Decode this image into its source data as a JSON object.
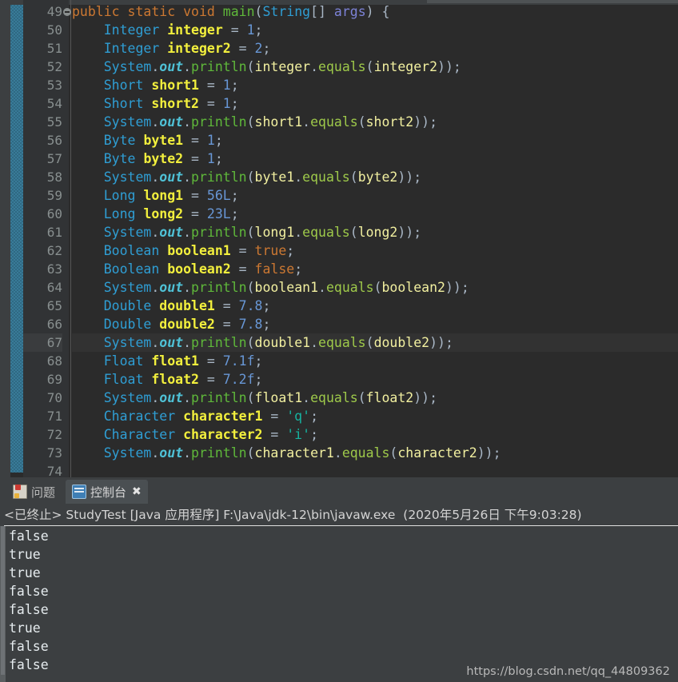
{
  "editor": {
    "top_partial_line": "",
    "current_line": 67,
    "lines": [
      {
        "n": "49",
        "fold": true,
        "tokens": [
          {
            "t": "public",
            "c": "kw"
          },
          {
            "t": " ",
            "c": "pn"
          },
          {
            "t": "static",
            "c": "kw"
          },
          {
            "t": " ",
            "c": "pn"
          },
          {
            "t": "void",
            "c": "kw"
          },
          {
            "t": " ",
            "c": "pn"
          },
          {
            "t": "main",
            "c": "mth"
          },
          {
            "t": "(",
            "c": "pn"
          },
          {
            "t": "String",
            "c": "cls"
          },
          {
            "t": "[] ",
            "c": "pn"
          },
          {
            "t": "args",
            "c": "args"
          },
          {
            "t": ") {",
            "c": "pn"
          }
        ]
      },
      {
        "n": "50",
        "fold": false,
        "tokens": [
          {
            "t": "    ",
            "c": "pn"
          },
          {
            "t": "Integer",
            "c": "type"
          },
          {
            "t": " ",
            "c": "pn"
          },
          {
            "t": "integer",
            "c": "var"
          },
          {
            "t": " = ",
            "c": "pn"
          },
          {
            "t": "1",
            "c": "num"
          },
          {
            "t": ";",
            "c": "semi"
          }
        ]
      },
      {
        "n": "51",
        "fold": false,
        "tokens": [
          {
            "t": "    ",
            "c": "pn"
          },
          {
            "t": "Integer",
            "c": "type"
          },
          {
            "t": " ",
            "c": "pn"
          },
          {
            "t": "integer2",
            "c": "var"
          },
          {
            "t": " = ",
            "c": "pn"
          },
          {
            "t": "2",
            "c": "num"
          },
          {
            "t": ";",
            "c": "semi"
          }
        ]
      },
      {
        "n": "52",
        "fold": false,
        "tokens": [
          {
            "t": "    ",
            "c": "pn"
          },
          {
            "t": "System",
            "c": "cls"
          },
          {
            "t": ".",
            "c": "pn"
          },
          {
            "t": "out",
            "c": "fld"
          },
          {
            "t": ".",
            "c": "pn"
          },
          {
            "t": "println",
            "c": "mth"
          },
          {
            "t": "(",
            "c": "pn"
          },
          {
            "t": "integer",
            "c": "varl"
          },
          {
            "t": ".",
            "c": "pn"
          },
          {
            "t": "equals",
            "c": "eqs"
          },
          {
            "t": "(",
            "c": "pn"
          },
          {
            "t": "integer2",
            "c": "varl"
          },
          {
            "t": "));",
            "c": "pn"
          }
        ]
      },
      {
        "n": "53",
        "fold": false,
        "tokens": [
          {
            "t": "    ",
            "c": "pn"
          },
          {
            "t": "Short",
            "c": "type"
          },
          {
            "t": " ",
            "c": "pn"
          },
          {
            "t": "short1",
            "c": "var"
          },
          {
            "t": " = ",
            "c": "pn"
          },
          {
            "t": "1",
            "c": "num"
          },
          {
            "t": ";",
            "c": "semi"
          }
        ]
      },
      {
        "n": "54",
        "fold": false,
        "tokens": [
          {
            "t": "    ",
            "c": "pn"
          },
          {
            "t": "Short",
            "c": "type"
          },
          {
            "t": " ",
            "c": "pn"
          },
          {
            "t": "short2",
            "c": "var"
          },
          {
            "t": " = ",
            "c": "pn"
          },
          {
            "t": "1",
            "c": "num"
          },
          {
            "t": ";",
            "c": "semi"
          }
        ]
      },
      {
        "n": "55",
        "fold": false,
        "tokens": [
          {
            "t": "    ",
            "c": "pn"
          },
          {
            "t": "System",
            "c": "cls"
          },
          {
            "t": ".",
            "c": "pn"
          },
          {
            "t": "out",
            "c": "fld"
          },
          {
            "t": ".",
            "c": "pn"
          },
          {
            "t": "println",
            "c": "mth"
          },
          {
            "t": "(",
            "c": "pn"
          },
          {
            "t": "short1",
            "c": "varl"
          },
          {
            "t": ".",
            "c": "pn"
          },
          {
            "t": "equals",
            "c": "eqs"
          },
          {
            "t": "(",
            "c": "pn"
          },
          {
            "t": "short2",
            "c": "varl"
          },
          {
            "t": "));",
            "c": "pn"
          }
        ]
      },
      {
        "n": "56",
        "fold": false,
        "tokens": [
          {
            "t": "    ",
            "c": "pn"
          },
          {
            "t": "Byte",
            "c": "type"
          },
          {
            "t": " ",
            "c": "pn"
          },
          {
            "t": "byte1",
            "c": "var"
          },
          {
            "t": " = ",
            "c": "pn"
          },
          {
            "t": "1",
            "c": "num"
          },
          {
            "t": ";",
            "c": "semi"
          }
        ]
      },
      {
        "n": "57",
        "fold": false,
        "tokens": [
          {
            "t": "    ",
            "c": "pn"
          },
          {
            "t": "Byte",
            "c": "type"
          },
          {
            "t": " ",
            "c": "pn"
          },
          {
            "t": "byte2",
            "c": "var"
          },
          {
            "t": " = ",
            "c": "pn"
          },
          {
            "t": "1",
            "c": "num"
          },
          {
            "t": ";",
            "c": "semi"
          }
        ]
      },
      {
        "n": "58",
        "fold": false,
        "tokens": [
          {
            "t": "    ",
            "c": "pn"
          },
          {
            "t": "System",
            "c": "cls"
          },
          {
            "t": ".",
            "c": "pn"
          },
          {
            "t": "out",
            "c": "fld"
          },
          {
            "t": ".",
            "c": "pn"
          },
          {
            "t": "println",
            "c": "mth"
          },
          {
            "t": "(",
            "c": "pn"
          },
          {
            "t": "byte1",
            "c": "varl"
          },
          {
            "t": ".",
            "c": "pn"
          },
          {
            "t": "equals",
            "c": "eqs"
          },
          {
            "t": "(",
            "c": "pn"
          },
          {
            "t": "byte2",
            "c": "varl"
          },
          {
            "t": "));",
            "c": "pn"
          }
        ]
      },
      {
        "n": "59",
        "fold": false,
        "tokens": [
          {
            "t": "    ",
            "c": "pn"
          },
          {
            "t": "Long",
            "c": "type"
          },
          {
            "t": " ",
            "c": "pn"
          },
          {
            "t": "long1",
            "c": "var"
          },
          {
            "t": " = ",
            "c": "pn"
          },
          {
            "t": "56L",
            "c": "num"
          },
          {
            "t": ";",
            "c": "semi"
          }
        ]
      },
      {
        "n": "60",
        "fold": false,
        "tokens": [
          {
            "t": "    ",
            "c": "pn"
          },
          {
            "t": "Long",
            "c": "type"
          },
          {
            "t": " ",
            "c": "pn"
          },
          {
            "t": "long2",
            "c": "var"
          },
          {
            "t": " = ",
            "c": "pn"
          },
          {
            "t": "23L",
            "c": "num"
          },
          {
            "t": ";",
            "c": "semi"
          }
        ]
      },
      {
        "n": "61",
        "fold": false,
        "tokens": [
          {
            "t": "    ",
            "c": "pn"
          },
          {
            "t": "System",
            "c": "cls"
          },
          {
            "t": ".",
            "c": "pn"
          },
          {
            "t": "out",
            "c": "fld"
          },
          {
            "t": ".",
            "c": "pn"
          },
          {
            "t": "println",
            "c": "mth"
          },
          {
            "t": "(",
            "c": "pn"
          },
          {
            "t": "long1",
            "c": "varl"
          },
          {
            "t": ".",
            "c": "pn"
          },
          {
            "t": "equals",
            "c": "eqs"
          },
          {
            "t": "(",
            "c": "pn"
          },
          {
            "t": "long2",
            "c": "varl"
          },
          {
            "t": "));",
            "c": "pn"
          }
        ]
      },
      {
        "n": "62",
        "fold": false,
        "tokens": [
          {
            "t": "    ",
            "c": "pn"
          },
          {
            "t": "Boolean",
            "c": "type"
          },
          {
            "t": " ",
            "c": "pn"
          },
          {
            "t": "boolean1",
            "c": "var"
          },
          {
            "t": " = ",
            "c": "pn"
          },
          {
            "t": "true",
            "c": "kw"
          },
          {
            "t": ";",
            "c": "semi"
          }
        ]
      },
      {
        "n": "63",
        "fold": false,
        "tokens": [
          {
            "t": "    ",
            "c": "pn"
          },
          {
            "t": "Boolean",
            "c": "type"
          },
          {
            "t": " ",
            "c": "pn"
          },
          {
            "t": "boolean2",
            "c": "var"
          },
          {
            "t": " = ",
            "c": "pn"
          },
          {
            "t": "false",
            "c": "kw"
          },
          {
            "t": ";",
            "c": "semi"
          }
        ]
      },
      {
        "n": "64",
        "fold": false,
        "tokens": [
          {
            "t": "    ",
            "c": "pn"
          },
          {
            "t": "System",
            "c": "cls"
          },
          {
            "t": ".",
            "c": "pn"
          },
          {
            "t": "out",
            "c": "fld"
          },
          {
            "t": ".",
            "c": "pn"
          },
          {
            "t": "println",
            "c": "mth"
          },
          {
            "t": "(",
            "c": "pn"
          },
          {
            "t": "boolean1",
            "c": "varl"
          },
          {
            "t": ".",
            "c": "pn"
          },
          {
            "t": "equals",
            "c": "eqs"
          },
          {
            "t": "(",
            "c": "pn"
          },
          {
            "t": "boolean2",
            "c": "varl"
          },
          {
            "t": "));",
            "c": "pn"
          }
        ]
      },
      {
        "n": "65",
        "fold": false,
        "tokens": [
          {
            "t": "    ",
            "c": "pn"
          },
          {
            "t": "Double",
            "c": "type"
          },
          {
            "t": " ",
            "c": "pn"
          },
          {
            "t": "double1",
            "c": "var"
          },
          {
            "t": " = ",
            "c": "pn"
          },
          {
            "t": "7.8",
            "c": "num"
          },
          {
            "t": ";",
            "c": "semi"
          }
        ]
      },
      {
        "n": "66",
        "fold": false,
        "tokens": [
          {
            "t": "    ",
            "c": "pn"
          },
          {
            "t": "Double",
            "c": "type"
          },
          {
            "t": " ",
            "c": "pn"
          },
          {
            "t": "double2",
            "c": "var"
          },
          {
            "t": " = ",
            "c": "pn"
          },
          {
            "t": "7.8",
            "c": "num"
          },
          {
            "t": ";",
            "c": "semi"
          }
        ]
      },
      {
        "n": "67",
        "fold": false,
        "tokens": [
          {
            "t": "    ",
            "c": "pn"
          },
          {
            "t": "System",
            "c": "cls"
          },
          {
            "t": ".",
            "c": "pn"
          },
          {
            "t": "out",
            "c": "fld"
          },
          {
            "t": ".",
            "c": "pn"
          },
          {
            "t": "println",
            "c": "mth"
          },
          {
            "t": "(",
            "c": "pn"
          },
          {
            "t": "double1",
            "c": "varl"
          },
          {
            "t": ".",
            "c": "pn"
          },
          {
            "t": "equals",
            "c": "eqs"
          },
          {
            "t": "(",
            "c": "pn"
          },
          {
            "t": "double2",
            "c": "varl"
          },
          {
            "t": "));",
            "c": "pn"
          }
        ]
      },
      {
        "n": "68",
        "fold": false,
        "tokens": [
          {
            "t": "    ",
            "c": "pn"
          },
          {
            "t": "Float",
            "c": "type"
          },
          {
            "t": " ",
            "c": "pn"
          },
          {
            "t": "float1",
            "c": "var"
          },
          {
            "t": " = ",
            "c": "pn"
          },
          {
            "t": "7.1f",
            "c": "num"
          },
          {
            "t": ";",
            "c": "semi"
          }
        ]
      },
      {
        "n": "69",
        "fold": false,
        "tokens": [
          {
            "t": "    ",
            "c": "pn"
          },
          {
            "t": "Float",
            "c": "type"
          },
          {
            "t": " ",
            "c": "pn"
          },
          {
            "t": "float2",
            "c": "var"
          },
          {
            "t": " = ",
            "c": "pn"
          },
          {
            "t": "7.2f",
            "c": "num"
          },
          {
            "t": ";",
            "c": "semi"
          }
        ]
      },
      {
        "n": "70",
        "fold": false,
        "tokens": [
          {
            "t": "    ",
            "c": "pn"
          },
          {
            "t": "System",
            "c": "cls"
          },
          {
            "t": ".",
            "c": "pn"
          },
          {
            "t": "out",
            "c": "fld"
          },
          {
            "t": ".",
            "c": "pn"
          },
          {
            "t": "println",
            "c": "mth"
          },
          {
            "t": "(",
            "c": "pn"
          },
          {
            "t": "float1",
            "c": "varl"
          },
          {
            "t": ".",
            "c": "pn"
          },
          {
            "t": "equals",
            "c": "eqs"
          },
          {
            "t": "(",
            "c": "pn"
          },
          {
            "t": "float2",
            "c": "varl"
          },
          {
            "t": "));",
            "c": "pn"
          }
        ]
      },
      {
        "n": "71",
        "fold": false,
        "tokens": [
          {
            "t": "    ",
            "c": "pn"
          },
          {
            "t": "Character",
            "c": "type"
          },
          {
            "t": " ",
            "c": "pn"
          },
          {
            "t": "character1",
            "c": "var"
          },
          {
            "t": " = ",
            "c": "pn"
          },
          {
            "t": "'q'",
            "c": "chr"
          },
          {
            "t": ";",
            "c": "semi"
          }
        ]
      },
      {
        "n": "72",
        "fold": false,
        "tokens": [
          {
            "t": "    ",
            "c": "pn"
          },
          {
            "t": "Character",
            "c": "type"
          },
          {
            "t": " ",
            "c": "pn"
          },
          {
            "t": "character2",
            "c": "var"
          },
          {
            "t": " = ",
            "c": "pn"
          },
          {
            "t": "'i'",
            "c": "chr"
          },
          {
            "t": ";",
            "c": "semi"
          }
        ]
      },
      {
        "n": "73",
        "fold": false,
        "tokens": [
          {
            "t": "    ",
            "c": "pn"
          },
          {
            "t": "System",
            "c": "cls"
          },
          {
            "t": ".",
            "c": "pn"
          },
          {
            "t": "out",
            "c": "fld"
          },
          {
            "t": ".",
            "c": "pn"
          },
          {
            "t": "println",
            "c": "mth"
          },
          {
            "t": "(",
            "c": "pn"
          },
          {
            "t": "character1",
            "c": "varl"
          },
          {
            "t": ".",
            "c": "pn"
          },
          {
            "t": "equals",
            "c": "eqs"
          },
          {
            "t": "(",
            "c": "pn"
          },
          {
            "t": "character2",
            "c": "varl"
          },
          {
            "t": "));",
            "c": "pn"
          }
        ]
      },
      {
        "n": "74",
        "fold": false,
        "tokens": []
      }
    ]
  },
  "panel": {
    "tabs": [
      {
        "label": "问题",
        "icon": "problems-icon",
        "active": false
      },
      {
        "label": "控制台",
        "icon": "console-icon",
        "active": true,
        "close_label": "✖"
      }
    ],
    "status": "<已终止> StudyTest [Java 应用程序] F:\\Java\\jdk-12\\bin\\javaw.exe  (2020年5月26日 下午9:03:28)",
    "output": [
      "false",
      "true",
      "true",
      "false",
      "false",
      "true",
      "false",
      "false"
    ],
    "watermark": "https://blog.csdn.net/qq_44809362"
  },
  "colors": {
    "editor_bg": "#2b2b2b",
    "gutter_bg": "#313335",
    "panel_bg": "#3c3f41",
    "keyword": "#cc7832",
    "type": "#2f9ed4",
    "method": "#5fb83a",
    "variable": "#f2ef3d",
    "number": "#6897d6",
    "char_literal": "#16b3a0",
    "anno_bar": "#3a7f9e"
  }
}
